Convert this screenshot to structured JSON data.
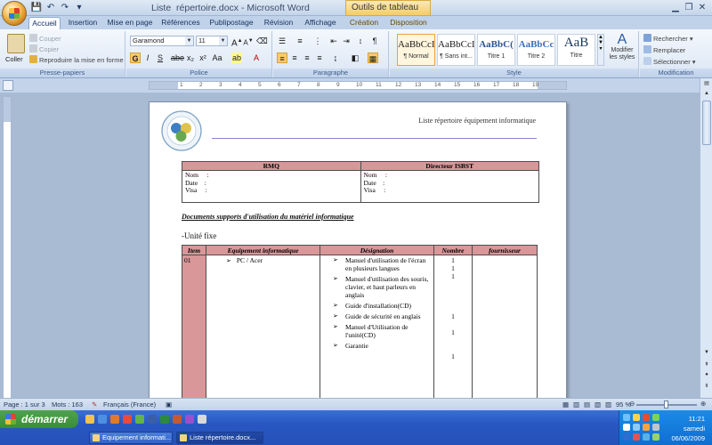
{
  "window": {
    "title": "Liste  répertoire.docx - Microsoft Word",
    "contextual_tab_group": "Outils de tableau"
  },
  "tabs": [
    "Accueil",
    "Insertion",
    "Mise en page",
    "Références",
    "Publipostage",
    "Révision",
    "Affichage",
    "Création",
    "Disposition"
  ],
  "ribbon": {
    "clipboard": {
      "paste": "Coller",
      "cut": "Couper",
      "copy": "Copier",
      "format_painter": "Reproduire la mise en forme",
      "label": "Presse-papiers"
    },
    "font": {
      "name": "Garamond",
      "size": "11",
      "label": "Police"
    },
    "paragraph": {
      "label": "Paragraphe"
    },
    "styles": {
      "items": [
        {
          "preview": "AaBbCcI",
          "name": "¶ Normal"
        },
        {
          "preview": "AaBbCcI",
          "name": "¶ Sans int..."
        },
        {
          "preview": "AaBbC(",
          "name": "Titre 1"
        },
        {
          "preview": "AaBbCc",
          "name": "Titre 2"
        },
        {
          "preview": "AaB",
          "name": "Titre"
        }
      ],
      "change": "Modifier les styles",
      "label": "Style"
    },
    "editing": {
      "find": "Rechercher",
      "replace": "Remplacer",
      "select": "Sélectionner",
      "label": "Modification"
    }
  },
  "ruler": {
    "ticks": [
      "1",
      "2",
      "3",
      "4",
      "5",
      "6",
      "7",
      "8",
      "9",
      "10",
      "11",
      "12",
      "13",
      "14",
      "15",
      "16",
      "17",
      "18",
      "19"
    ]
  },
  "document": {
    "header_text": "Liste répertoire équipement informatique",
    "signature_table": {
      "headers": [
        "RMQ",
        "Directeur ISBST"
      ],
      "fields": [
        "Nom     :",
        "Date    :",
        "Visa     :"
      ]
    },
    "heading": "Documents supports d'utilisation du matériel informatique",
    "unit_label": "-Unité fixe",
    "equipment_table": {
      "headers": [
        "Item",
        "Equipement informatique",
        "Désignation",
        "Nombre",
        "fournisseur"
      ],
      "row": {
        "item": "01",
        "equipment": "PC / Acer",
        "designations": [
          "Manuel d'utilisation de l'écran en plusieurs langues",
          "Manuel d'utilisation des souris, clavier, et haut parleurs en anglais",
          "Guide d'installation(CD)",
          "Guide de sécurité en anglais",
          "Manuel d'Utilisation de l'unité(CD)",
          "Garantie"
        ],
        "counts": [
          "1",
          "1",
          "1",
          "",
          "",
          "",
          "",
          "1",
          "",
          "1",
          "",
          "",
          "1"
        ]
      }
    }
  },
  "statusbar": {
    "page": "Page : 1 sur 3",
    "words": "Mots : 163",
    "language": "Français (France)",
    "zoom": "95 %"
  },
  "taskbar": {
    "start": "démarrer",
    "tasks": [
      "Equipement informati...",
      "Liste  répertoire.docx..."
    ],
    "clock": {
      "time": "11:21",
      "day": "samedi",
      "date": "06/06/2009"
    }
  }
}
